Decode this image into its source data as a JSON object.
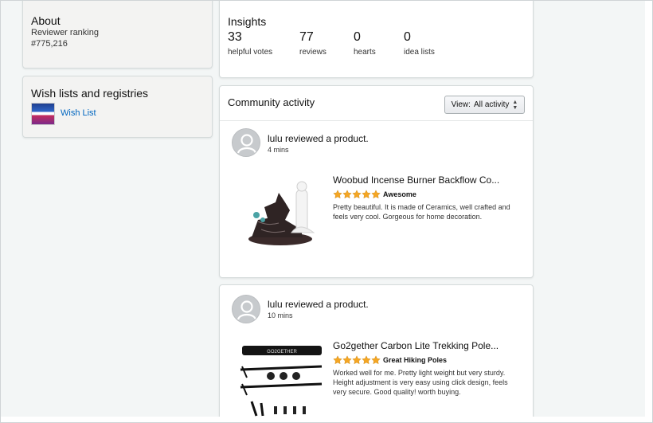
{
  "about": {
    "title": "About",
    "ranking_label": "Reviewer ranking",
    "ranking_value": "#775,216"
  },
  "wishlists": {
    "title": "Wish lists and registries",
    "items": [
      {
        "label": "Wish List"
      }
    ]
  },
  "insights": {
    "title": "Insights",
    "stats": [
      {
        "value": "33",
        "label": "helpful votes"
      },
      {
        "value": "77",
        "label": "reviews"
      },
      {
        "value": "0",
        "label": "hearts"
      },
      {
        "value": "0",
        "label": "idea lists"
      }
    ]
  },
  "community": {
    "title": "Community activity",
    "view_label": "View:",
    "view_value": "All activity",
    "posts": [
      {
        "headline": "lulu reviewed a product.",
        "time": "4 mins",
        "product_title": "Woobud Incense Burner Backflow Co...",
        "rating": 5,
        "review_title": "Awesome",
        "review_body": "Pretty beautiful. It is made of Ceramics, well crafted and feels very cool. Gorgeous for home decoration.",
        "image_icon": "incense-burner-image"
      },
      {
        "headline": "lulu reviewed a product.",
        "time": "10 mins",
        "product_title": "Go2gether Carbon Lite Trekking Pole...",
        "rating": 5,
        "review_title": "Great Hiking Poles",
        "review_body": "Worked well for me. Pretty light weight but very sturdy. Height adjustment is very easy using click design, feels very secure. Good quality! worth buying.",
        "image_icon": "trekking-poles-image",
        "image_brand_text": "GO2GETHER"
      }
    ]
  },
  "colors": {
    "page_bg": "#f3f6f6",
    "link": "#0066c0",
    "star": "#f5a623",
    "card_border": "#d5dbdb"
  }
}
